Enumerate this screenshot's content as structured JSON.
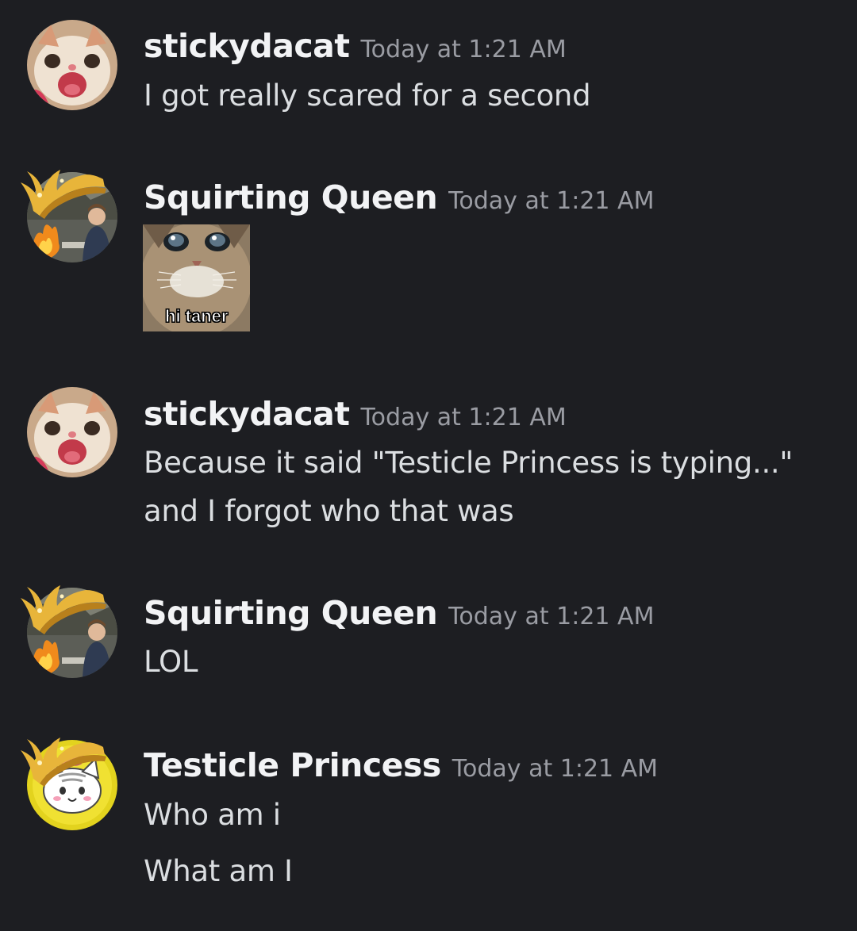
{
  "messages": [
    {
      "username": "stickydacat",
      "timestamp": "Today at 1:21 AM",
      "lines": [
        "I got really scared for a second"
      ]
    },
    {
      "username": "Squirting Queen",
      "timestamp": "Today at 1:21 AM",
      "sticker_caption": "hi taner"
    },
    {
      "username": "stickydacat",
      "timestamp": "Today at 1:21 AM",
      "lines": [
        "Because it said \"Testicle Princess is typing...\"",
        "and I forgot who that was"
      ]
    },
    {
      "username": "Squirting Queen",
      "timestamp": "Today at 1:21 AM",
      "lines": [
        "LOL"
      ]
    },
    {
      "username": "Testicle Princess",
      "timestamp": "Today at 1:21 AM",
      "lines": [
        "Who am i",
        "What am I"
      ]
    }
  ],
  "colors": {
    "background": "#1d1e22",
    "username": "#f2f3f5",
    "timestamp": "#9a9ca3",
    "message_text": "#dbdee1",
    "crown_gold": "#e8b53a"
  }
}
